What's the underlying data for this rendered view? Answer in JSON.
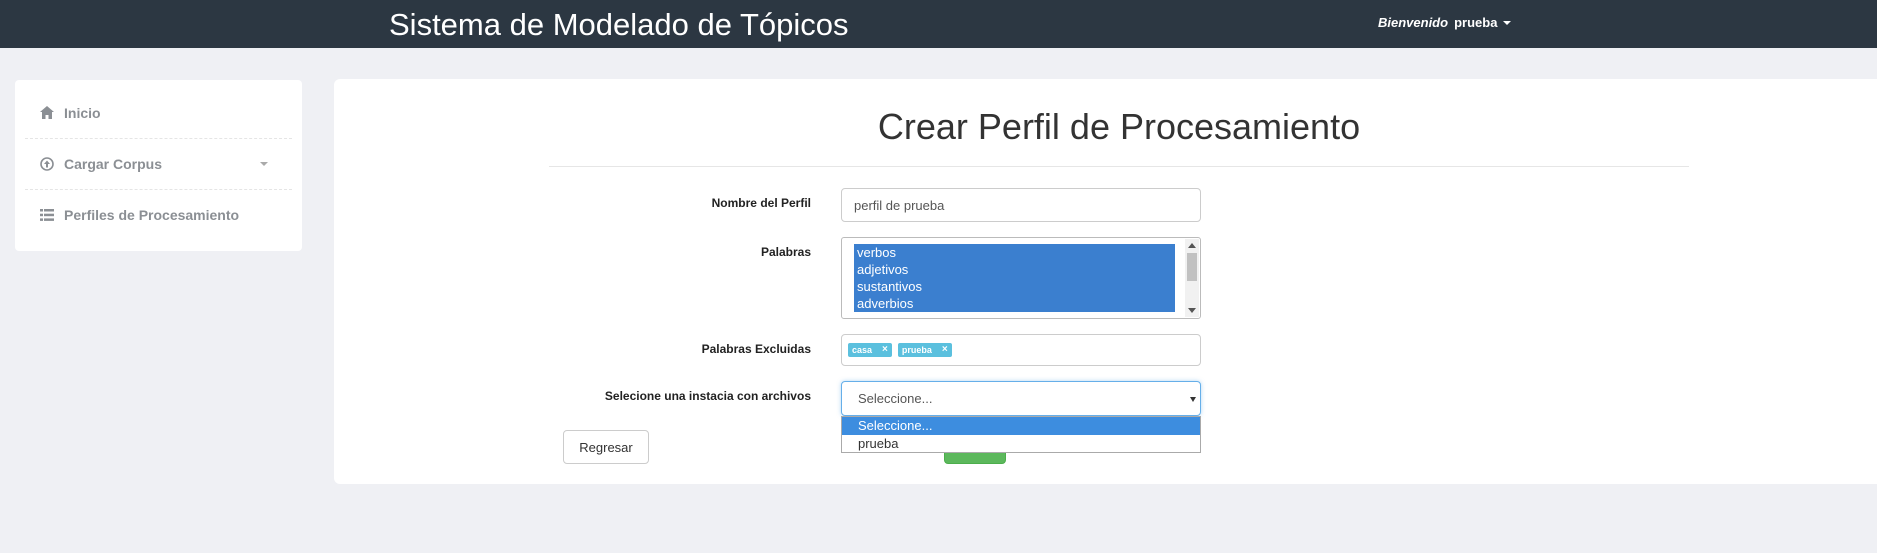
{
  "app": {
    "title": "Sistema de Modelado de Tópicos"
  },
  "user_menu": {
    "welcome": "Bienvenido",
    "username": "prueba"
  },
  "sidebar": {
    "items": [
      {
        "label": "Inicio",
        "icon": "home-icon"
      },
      {
        "label": "Cargar Corpus",
        "icon": "upload-icon",
        "has_caret": true
      },
      {
        "label": "Perfiles de Procesamiento",
        "icon": "list-icon"
      }
    ]
  },
  "page": {
    "title": "Crear Perfil de Procesamiento"
  },
  "form": {
    "profile_name": {
      "label": "Nombre del Perfil",
      "value": "perfil de prueba"
    },
    "words": {
      "label": "Palabras",
      "options": [
        "verbos",
        "adjetivos",
        "sustantivos",
        "adverbios"
      ],
      "selected": [
        "verbos",
        "adjetivos",
        "sustantivos",
        "adverbios"
      ]
    },
    "excluded_words": {
      "label": "Palabras Excluidas",
      "tags": [
        "casa",
        "prueba"
      ]
    },
    "instance": {
      "label": "Selecione una instacia con archivos",
      "value": "Seleccione...",
      "options": [
        "Seleccione...",
        "prueba"
      ]
    },
    "back_button": "Regresar"
  },
  "colors": {
    "navbar": "#2c3742",
    "selection": "#3b7fcf",
    "tag": "#5bc0de",
    "success": "#5cb85c"
  }
}
